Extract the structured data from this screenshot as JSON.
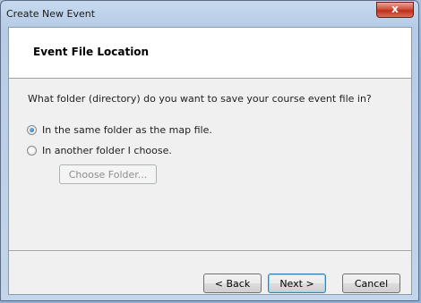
{
  "window": {
    "title": "Create New Event",
    "close_label": "x"
  },
  "header": {
    "title": "Event File Location"
  },
  "question": "What folder (directory) do you want to save your course event file in?",
  "options": [
    {
      "label": "In the same folder as the map file.",
      "checked": true
    },
    {
      "label": "In another folder I choose.",
      "checked": false
    }
  ],
  "choose_folder_label": "Choose Folder...",
  "buttons": {
    "back": "< Back",
    "next": "Next >",
    "cancel": "Cancel"
  }
}
